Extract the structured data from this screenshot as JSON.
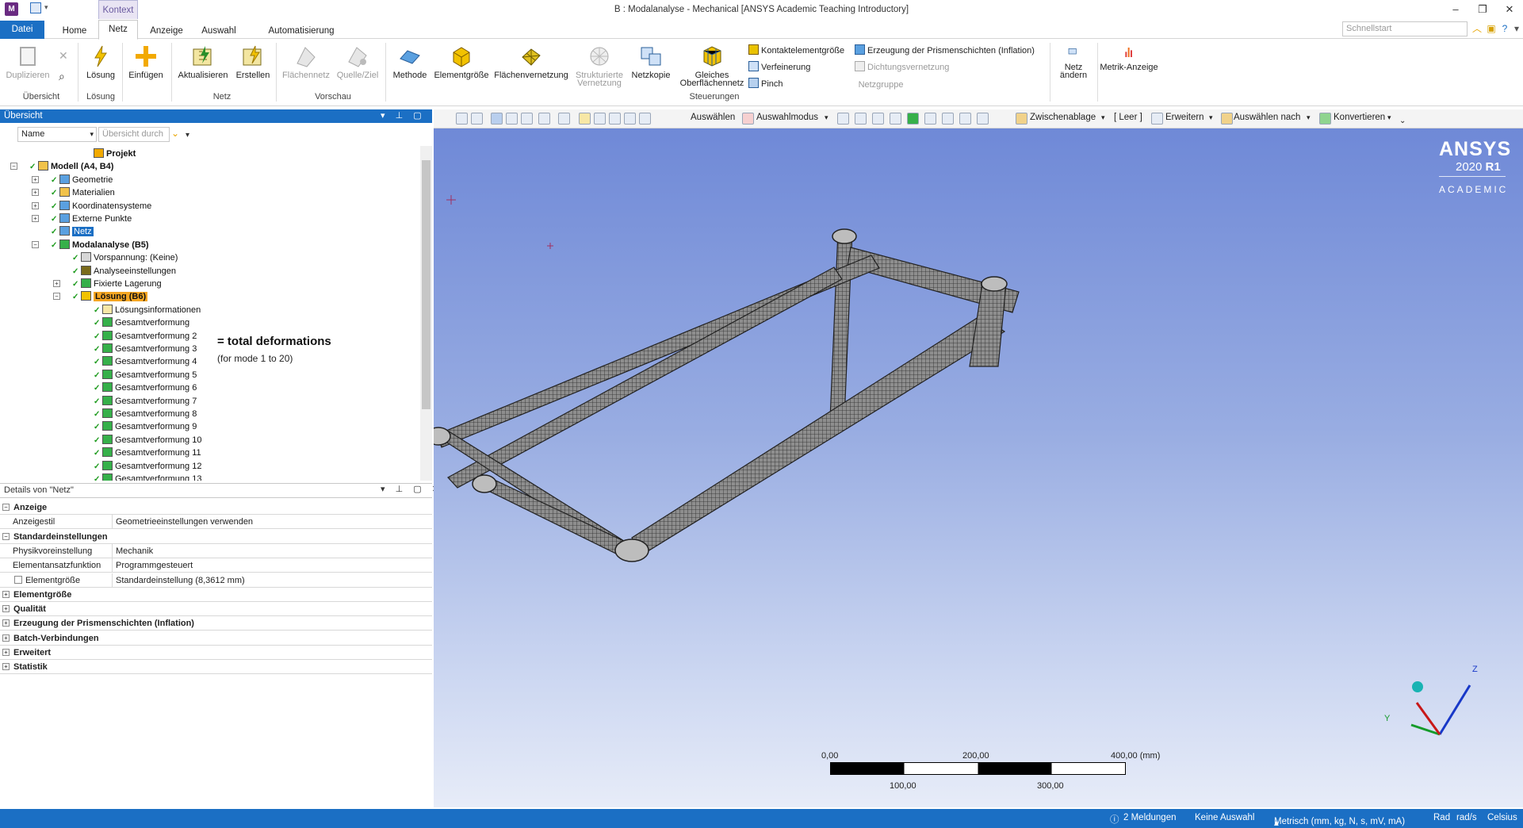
{
  "window": {
    "title": "B : Modalanalyse - Mechanical [ANSYS Academic Teaching Introductory]",
    "app_icon_letter": "M",
    "context_tab": "Kontext"
  },
  "ribbon_tabs": [
    "Datei",
    "Home",
    "Netz",
    "Anzeige",
    "Auswahl",
    "Automatisierung"
  ],
  "quicksearch_placeholder": "Schnellstart",
  "ribbon": {
    "groups": {
      "uebersicht": "Übersicht",
      "loesung": "Lösung",
      "netz": "Netz",
      "vorschau": "Vorschau",
      "steuerungen": "Steuerungen",
      "netzgruppe": "Netzgruppe"
    },
    "buttons": {
      "duplizieren": "Duplizieren",
      "loesung": "Lösung",
      "einfuegen": "Einfügen",
      "aktualisieren": "Aktualisieren",
      "erstellen": "Erstellen",
      "flaechennetz": "Flächennetz",
      "quelle_ziel": "Quelle/Ziel",
      "methode": "Methode",
      "elementgroesse": "Elementgröße",
      "flaechenvernetzung": "Flächenvernetzung",
      "strukturierte_1": "Strukturierte",
      "strukturierte_2": "Vernetzung",
      "netzkopie": "Netzkopie",
      "gleiches_1": "Gleiches",
      "gleiches_2": "Oberflächennetz",
      "netz_aendern_1": "Netz",
      "netz_aendern_2": "ändern",
      "metrik": "Metrik-Anzeige"
    },
    "small": {
      "kontakt": "Kontaktelementgröße",
      "verfeinerung": "Verfeinerung",
      "pinch": "Pinch",
      "inflation": "Erzeugung der Prismenschichten (Inflation)",
      "dichtung": "Dichtungsvernetzung"
    }
  },
  "outline": {
    "header": "Übersicht",
    "filter_name": "Name",
    "filter_search_placeholder": "Übersicht durch",
    "tree": [
      {
        "label": "Projekt",
        "bold": true
      },
      {
        "label": "Modell (A4, B4)",
        "bold": true
      },
      {
        "label": "Geometrie"
      },
      {
        "label": "Materialien"
      },
      {
        "label": "Koordinatensysteme"
      },
      {
        "label": "Externe Punkte"
      },
      {
        "label": "Netz",
        "selected": true
      },
      {
        "label": "Modalanalyse (B5)",
        "bold": true
      },
      {
        "label": "Vorspannung: (Keine)"
      },
      {
        "label": "Analyseeinstellungen"
      },
      {
        "label": "Fixierte Lagerung"
      },
      {
        "label": "Lösung (B6)",
        "bold": true,
        "highlight": true
      },
      {
        "label": "Lösungsinformationen"
      },
      {
        "label": "Gesamtverformung"
      },
      {
        "label": "Gesamtverformung 2"
      },
      {
        "label": "Gesamtverformung 3"
      },
      {
        "label": "Gesamtverformung 4"
      },
      {
        "label": "Gesamtverformung 5"
      },
      {
        "label": "Gesamtverformung 6"
      },
      {
        "label": "Gesamtverformung 7"
      },
      {
        "label": "Gesamtverformung 8"
      },
      {
        "label": "Gesamtverformung 9"
      },
      {
        "label": "Gesamtverformung 10"
      },
      {
        "label": "Gesamtverformung 11"
      },
      {
        "label": "Gesamtverformung 12"
      },
      {
        "label": "Gesamtverformung 13"
      }
    ],
    "annotation_title": "= total deformations",
    "annotation_sub": "(for mode 1 to 20)"
  },
  "details": {
    "header": "Details von \"Netz\"",
    "rows": [
      {
        "type": "section",
        "label": "Anzeige",
        "expanded": true
      },
      {
        "type": "prop",
        "label": "Anzeigestil",
        "value": "Geometrieeinstellungen verwenden"
      },
      {
        "type": "section",
        "label": "Standardeinstellungen",
        "expanded": true
      },
      {
        "type": "prop",
        "label": "Physikvoreinstellung",
        "value": "Mechanik"
      },
      {
        "type": "prop",
        "label": "Elementansatzfunktion",
        "value": "Programmgesteuert"
      },
      {
        "type": "propcheck",
        "label": "Elementgröße",
        "value": "Standardeinstellung (8,3612 mm)"
      },
      {
        "type": "section",
        "label": "Elementgröße",
        "expanded": false
      },
      {
        "type": "section",
        "label": "Qualität",
        "expanded": false
      },
      {
        "type": "section",
        "label": "Erzeugung der Prismenschichten (Inflation)",
        "expanded": false
      },
      {
        "type": "section",
        "label": "Batch-Verbindungen",
        "expanded": false
      },
      {
        "type": "section",
        "label": "Erweitert",
        "expanded": false
      },
      {
        "type": "section",
        "label": "Statistik",
        "expanded": false
      }
    ]
  },
  "graphics_toolbar": {
    "auswaehlen": "Auswählen",
    "auswahlmodus": "Auswahlmodus",
    "zwischenablage": "Zwischenablage",
    "leer": "[ Leer ]",
    "erweitern": "Erweitern",
    "auswaehlen_nach": "Auswählen nach",
    "konvertieren": "Konvertieren"
  },
  "viewport": {
    "logo": "ANSYS",
    "version": "2020",
    "release": "R1",
    "edition": "ACADEMIC",
    "axes": {
      "z": "Z",
      "y": "Y"
    },
    "scale": {
      "t0": "0,00",
      "t200": "200,00",
      "t400": "400,00 (mm)",
      "t100": "100,00",
      "t300": "300,00"
    }
  },
  "status": {
    "messages": "2 Meldungen",
    "selection": "Keine Auswahl",
    "units": "Metrisch (mm, kg, N, s, mV, mA)",
    "angle": "Rad",
    "rotation": "rad/s",
    "temperature": "Celsius"
  },
  "colors": {
    "accent": "#1b6fc4",
    "selection_orange": "#f5a623",
    "context_tab": "#6a5aa0"
  }
}
